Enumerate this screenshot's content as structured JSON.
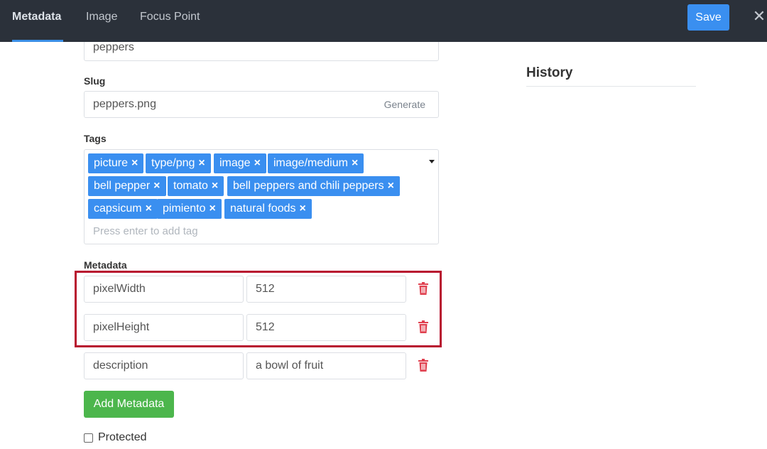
{
  "header": {
    "tabs": [
      {
        "label": "Metadata",
        "active": true
      },
      {
        "label": "Image",
        "active": false
      },
      {
        "label": "Focus Point",
        "active": false
      }
    ],
    "save_label": "Save",
    "close_icon": "close-icon"
  },
  "form": {
    "name_value": "peppers",
    "slug": {
      "label": "Slug",
      "value": "peppers.png",
      "generate_label": "Generate"
    },
    "tags": {
      "label": "Tags",
      "items": [
        "picture",
        "type/png",
        "image",
        "image/medium",
        "bell pepper",
        "tomato",
        "bell peppers and chili peppers",
        "capsicum",
        "pimiento",
        "natural foods"
      ],
      "remove_glyph": "×",
      "placeholder": "Press enter to add tag"
    },
    "metadata": {
      "label": "Metadata",
      "rows": [
        {
          "key": "pixelWidth",
          "value": "512"
        },
        {
          "key": "pixelHeight",
          "value": "512"
        },
        {
          "key": "description",
          "value": "a bowl of fruit"
        }
      ],
      "add_label": "Add Metadata"
    },
    "protected_label": "Protected",
    "protected_checked": false
  },
  "history": {
    "title": "History"
  },
  "colors": {
    "accent": "#3a8ff0",
    "topbar": "#2b313a",
    "success": "#4cb64c",
    "danger": "#e0404f",
    "highlight": "#b8122f"
  }
}
